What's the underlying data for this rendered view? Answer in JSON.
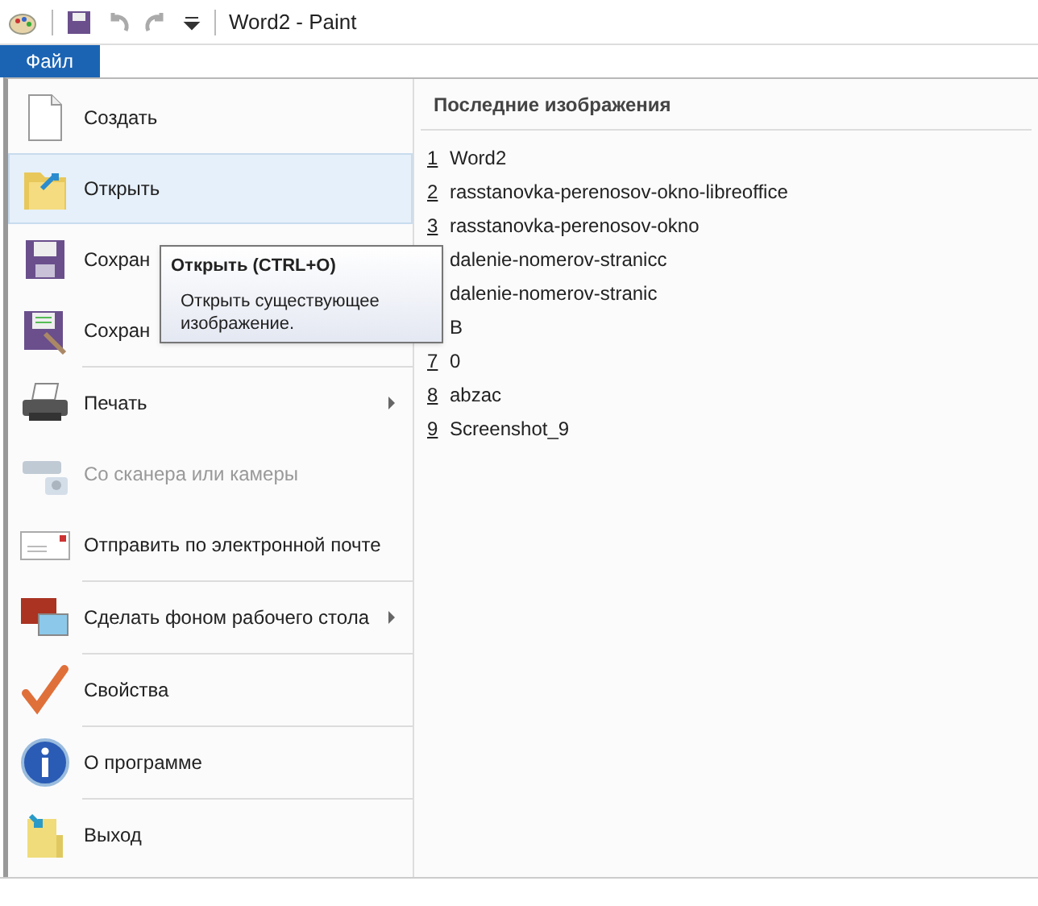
{
  "window": {
    "title": "Word2 - Paint"
  },
  "ribbon_tabs": [
    {
      "label": "Файл",
      "selected": true
    }
  ],
  "menu": [
    {
      "label": "Создать",
      "selected": false,
      "disabled": false,
      "submenu": false,
      "separator_above": false
    },
    {
      "label": "Открыть",
      "selected": true,
      "disabled": false,
      "submenu": false,
      "separator_above": false
    },
    {
      "label": "Сохран",
      "selected": false,
      "disabled": false,
      "separator_above": false
    },
    {
      "label": "Сохран",
      "selected": false,
      "disabled": false,
      "separator_above": false
    },
    {
      "label": "Печать",
      "selected": false,
      "disabled": false,
      "submenu": true,
      "separator_above": true
    },
    {
      "label": "Со сканера или камеры",
      "selected": false,
      "disabled": true,
      "submenu": false,
      "separator_above": false
    },
    {
      "label": "Отправить по электронной почте",
      "selected": false,
      "disabled": false,
      "submenu": false,
      "separator_above": false
    },
    {
      "label": "Сделать фоном рабочего стола",
      "selected": false,
      "disabled": false,
      "submenu": true,
      "separator_above": true
    },
    {
      "label": "Свойства",
      "selected": false,
      "disabled": false,
      "submenu": false,
      "separator_above": true
    },
    {
      "label": "О программе",
      "selected": false,
      "disabled": false,
      "submenu": false,
      "separator_above": true
    },
    {
      "label": "Выход",
      "selected": false,
      "disabled": false,
      "submenu": false,
      "separator_above": true
    }
  ],
  "recent": {
    "title": "Последние изображения",
    "items": [
      {
        "number": "1",
        "name": "Word2"
      },
      {
        "number": "2",
        "name": "rasstanovka-perenosov-okno-libreoffice"
      },
      {
        "number": "3",
        "name": "rasstanovka-perenosov-okno"
      },
      {
        "name": "dalenie-nomerov-stranicc"
      },
      {
        "name": "dalenie-nomerov-stranic"
      },
      {
        "name": "B"
      },
      {
        "number": "7",
        "name": "0"
      },
      {
        "number": "8",
        "name": "abzac"
      },
      {
        "number": "9",
        "name": "Screenshot_9"
      }
    ]
  },
  "tooltip": {
    "title": "Открыть (CTRL+O)",
    "text": "Открыть существующее изображение."
  }
}
